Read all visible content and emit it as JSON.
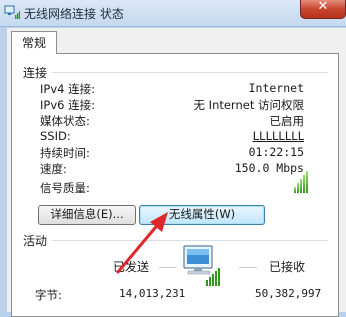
{
  "window": {
    "title": "无线网络连接 状态",
    "close_glyph": "✕"
  },
  "tabs": [
    {
      "label": "常规"
    }
  ],
  "connection": {
    "section_label": "连接",
    "rows": [
      {
        "label": "IPv4 连接:",
        "value": "Internet"
      },
      {
        "label": "IPv6 连接:",
        "value": "无 Internet 访问权限"
      },
      {
        "label": "媒体状态:",
        "value": "已启用"
      },
      {
        "label": "SSID:",
        "value": "LLLLLLLL"
      },
      {
        "label": "持续时间:",
        "value": "01:22:15"
      },
      {
        "label": "速度:",
        "value": "150.0 Mbps"
      }
    ],
    "signal_label": "信号质量:",
    "signal_level": "5/5"
  },
  "buttons": {
    "details": "详细信息(E)...",
    "wireless_properties": "无线属性(W)"
  },
  "activity": {
    "section_label": "活动",
    "sent_label": "已发送",
    "received_label": "已接收",
    "bytes_label": "字节:",
    "bytes_sent": "14,013,231",
    "bytes_received": "50,382,997"
  },
  "colors": {
    "annotation_arrow": "#e0262a",
    "signal_green": "#2f9a1a"
  }
}
